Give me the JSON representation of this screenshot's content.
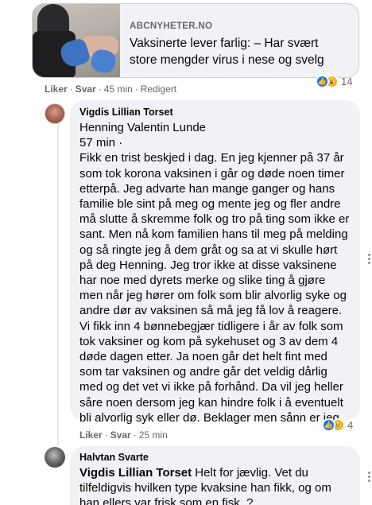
{
  "link_preview": {
    "domain": "ABCNYHETER.NO",
    "title": "Vaksinerte lever farlig: – Har svært store mengder virus i nese og svelg"
  },
  "post_meta": {
    "like": "Liker",
    "reply": "Svar",
    "time": "45 min",
    "edited": "Redigert",
    "reaction_count": "14"
  },
  "comment1": {
    "author": "Vigdis Lillian Torset",
    "body": "Henning Valentin Lunde\n57 min ·\nFikk en trist beskjed i dag. En jeg kjenner på 37 år som tok korona vaksinen i går og døde noen timer etterpå. Jeg advarte han mange ganger og hans familie ble sint på meg og mente jeg og fler andre må slutte å skremme folk og tro på ting som ikke er sant. Men nå kom familien hans til meg på melding og så ringte jeg å dem gråt og sa at vi skulle hørt på deg Henning. Jeg tror ikke at disse vaksinene har noe med dyrets merke og slike ting å gjøre men når jeg hører om folk som blir alvorlig syke og andre dør av vaksinen så må jeg få lov å reagere. Vi fikk inn 4 bønnebegjær tidligere i år av folk som tok vaksiner og kom på sykehuset og 3 av dem 4 døde dagen etter. Ja noen går det helt fint med som tar vaksinen og andre går det veldig dårlig med og det vet vi ikke på forhånd. Da vil jeg heller såre noen dersom jeg kan hindre folk i å eventuelt bli alvorlig syk eller dø. Beklager men sånn er jeg.",
    "like": "Liker",
    "reply": "Svar",
    "time": "25 min",
    "reaction_count": "4"
  },
  "comment2": {
    "author": "Halvtan Svarte",
    "mention": "Vigdis Lillian Torset",
    "body": " Helt for jævlig. Vet du tilfeldigvis hvilken type kvaksine han fikk, og om han ellers var frisk som en fisk..?"
  },
  "icons": [
    "like-reaction-icon",
    "wow-reaction-icon",
    "sad-reaction-icon",
    "more-options-icon"
  ],
  "colors": {
    "bubble": "#f0f2f5",
    "meta": "#65676b",
    "like": "#1877f2",
    "emoji": "#f7b125"
  }
}
